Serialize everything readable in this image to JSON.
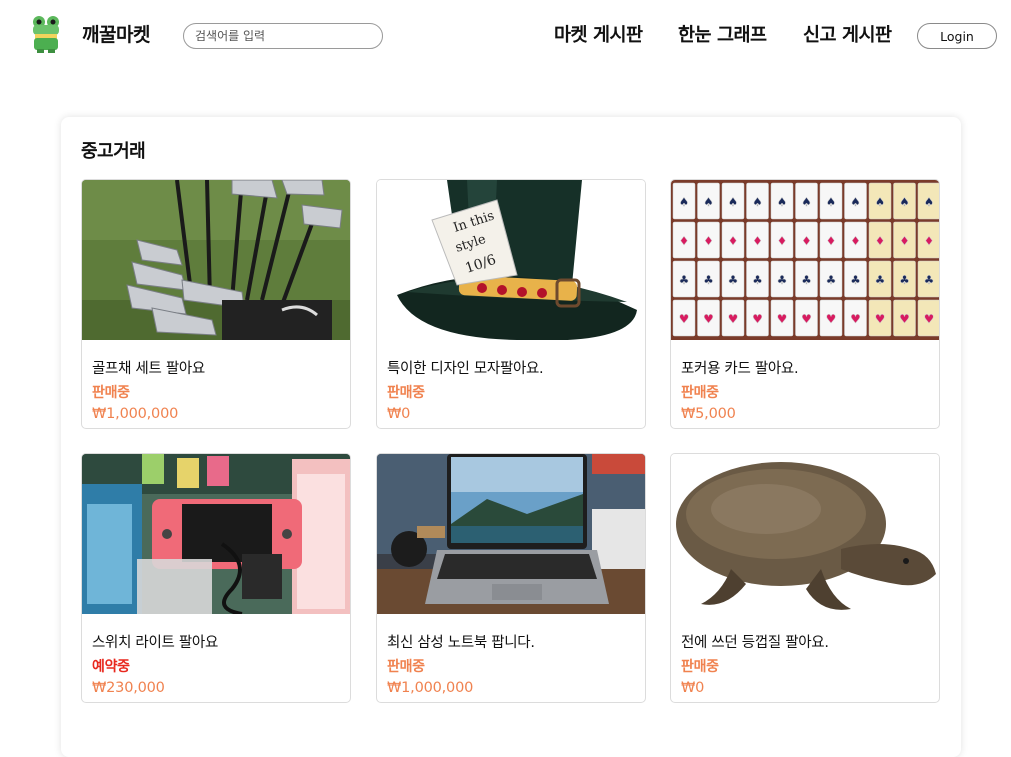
{
  "header": {
    "brand": "깨꿀마켓",
    "search_placeholder": "검색어를 입력",
    "nav": {
      "market": "마켓 게시판",
      "graph": "한눈 그래프",
      "report": "신고 게시판"
    },
    "login_label": "Login"
  },
  "colors": {
    "status_selling": "#f0824f",
    "status_reserved": "#e8281e",
    "price": "#f0824f"
  },
  "section": {
    "title": "중고거래"
  },
  "products": [
    {
      "title": "골프채 세트 팔아요",
      "status": "판매중",
      "status_type": "selling",
      "price": "₩1,000,000",
      "image": "golf-clubs"
    },
    {
      "title": "특이한 디자인 모자팔아요.",
      "status": "판매중",
      "status_type": "selling",
      "price": "₩0",
      "image": "mad-hatter-hat"
    },
    {
      "title": "포커용 카드 팔아요.",
      "status": "판매중",
      "status_type": "selling",
      "price": "₩5,000",
      "image": "playing-cards"
    },
    {
      "title": "스위치 라이트 팔아요",
      "status": "예약중",
      "status_type": "reserved",
      "price": "₩230,000",
      "image": "switch-lite"
    },
    {
      "title": "최신 삼성 노트북 팝니다.",
      "status": "판매중",
      "status_type": "selling",
      "price": "₩1,000,000",
      "image": "laptop"
    },
    {
      "title": "전에 쓰던 등껍질 팔아요.",
      "status": "판매중",
      "status_type": "selling",
      "price": "₩0",
      "image": "turtle"
    }
  ]
}
